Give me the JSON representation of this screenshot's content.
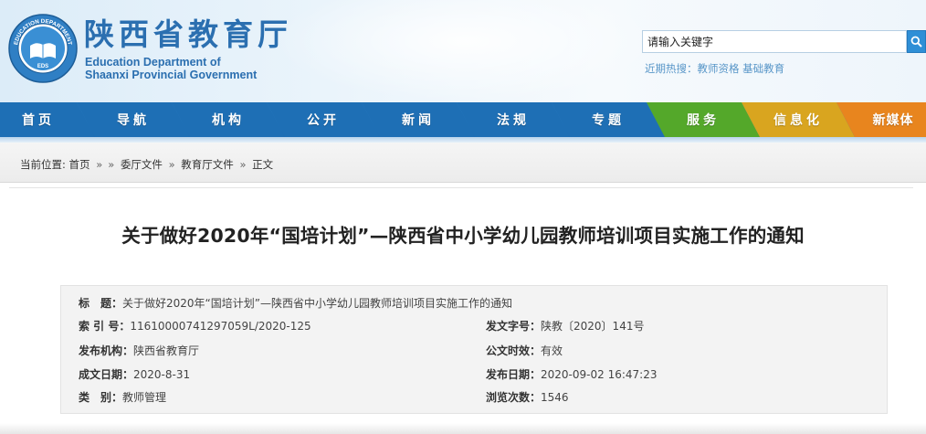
{
  "header": {
    "logo_cn": "陕西省教育厅",
    "logo_en_line1": "Education Department of",
    "logo_en_line2": "Shaanxi Provincial Government",
    "emblem": {
      "top_text": "EDUCATION DEPARTMENT",
      "center_text": "EDS",
      "icon": "open-book-icon"
    },
    "search": {
      "placeholder": "请输入关键字",
      "icon": "search-icon"
    },
    "hot_label": "近期热搜：",
    "hot_terms": [
      "教师资格",
      "基础教育"
    ]
  },
  "nav": {
    "items": [
      {
        "label": "首页",
        "color": "#1e6fb5"
      },
      {
        "label": "导航",
        "color": "#1e6fb5"
      },
      {
        "label": "机构",
        "color": "#1e6fb5"
      },
      {
        "label": "公开",
        "color": "#1e6fb5"
      },
      {
        "label": "新闻",
        "color": "#1e6fb5"
      },
      {
        "label": "法规",
        "color": "#1e6fb5"
      },
      {
        "label": "专题",
        "color": "#1e6fb5"
      },
      {
        "label": "服务",
        "color": "#54a82a"
      },
      {
        "label": "信息化",
        "color": "#d9a51f"
      },
      {
        "label": "新媒体",
        "color": "#e8851e"
      }
    ]
  },
  "breadcrumb": {
    "prefix": "当前位置:",
    "items": [
      "首页",
      "»",
      "»",
      "委厅文件",
      "»",
      "教育厅文件",
      "»",
      "正文"
    ]
  },
  "document": {
    "title": "关于做好2020年“国培计划”—陕西省中小学幼儿园教师培训项目实施工作的通知",
    "meta": {
      "subject_label": "标　题：",
      "subject_value": "关于做好2020年“国培计划”—陕西省中小学幼儿园教师培训项目实施工作的通知",
      "index_label": "索 引 号：",
      "index_value": "11610000741297059L/2020-125",
      "doc_no_label": "发文字号：",
      "doc_no_value": "陕教〔2020〕141号",
      "issuer_label": "发布机构：",
      "issuer_value": "陕西省教育厅",
      "validity_label": "公文时效：",
      "validity_value": "有效",
      "written_date_label": "成文日期：",
      "written_date_value": "2020-8-31",
      "publish_date_label": "发布日期：",
      "publish_date_value": "2020-09-02 16:47:23",
      "category_label": "类　别：",
      "category_value": "教师管理",
      "views_label": "浏览次数：",
      "views_value": "1546"
    }
  },
  "colors": {
    "brand_blue": "#2b6fb0",
    "nav_blue": "#1e6fb5",
    "service_green": "#54a82a",
    "info_yellow": "#d9a51f",
    "media_orange": "#e8851e"
  }
}
